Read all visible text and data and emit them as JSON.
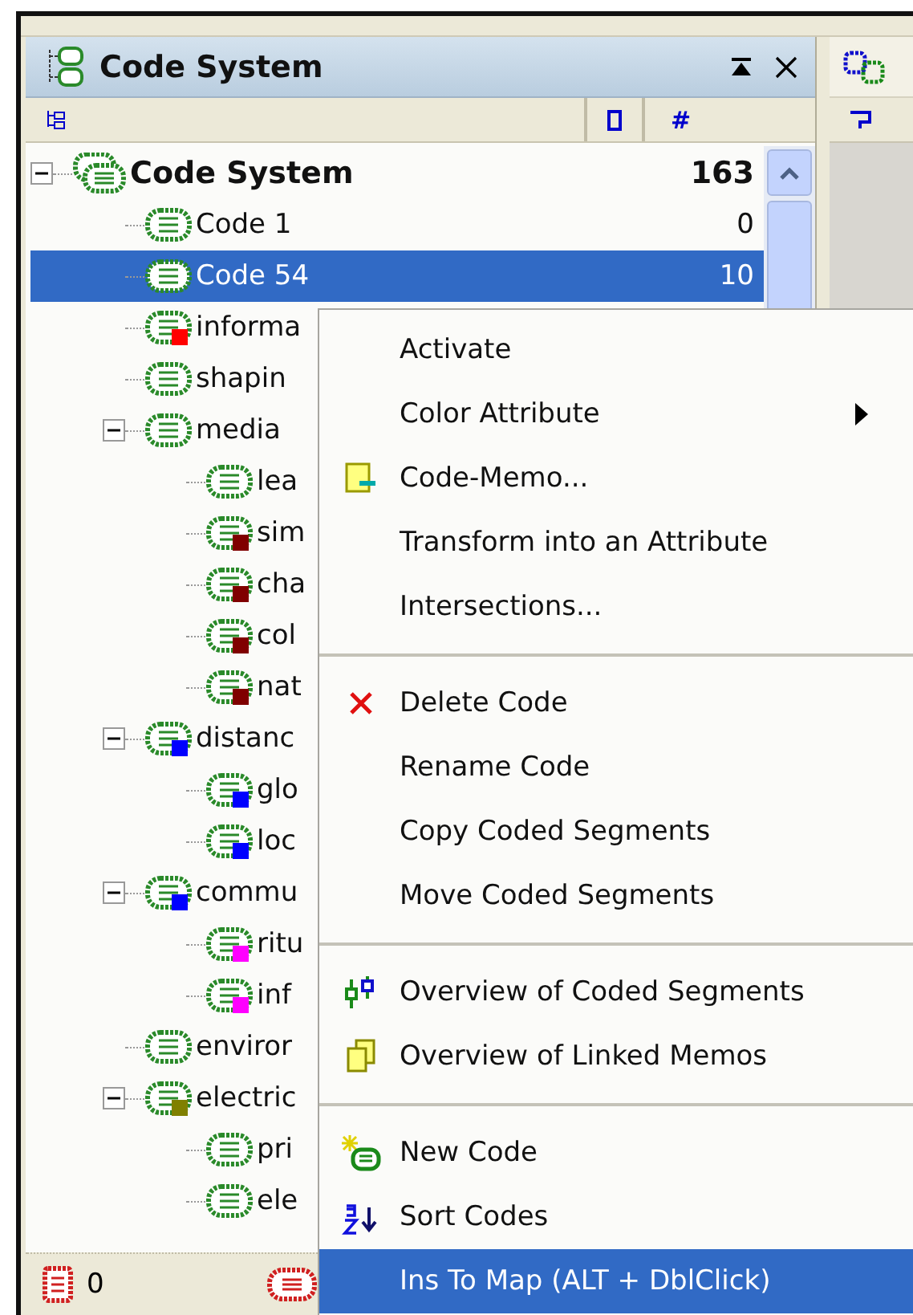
{
  "panel": {
    "title": "Code System",
    "count_header": "#"
  },
  "tree": [
    {
      "label": "Code System",
      "count": "163",
      "expanded": true,
      "selected": false,
      "children": [
        {
          "label": "Code 1",
          "count": "0",
          "selected": false
        },
        {
          "label": "Code 54",
          "count": "10",
          "selected": true
        },
        {
          "label": "informa",
          "color": "#ff0000",
          "selected": false
        },
        {
          "label": "shapin",
          "selected": false
        },
        {
          "label": "media",
          "expanded": true,
          "selected": false,
          "children": [
            {
              "label": "lea",
              "selected": false
            },
            {
              "label": "sim",
              "color": "#800000",
              "selected": false
            },
            {
              "label": "cha",
              "color": "#800000",
              "selected": false
            },
            {
              "label": "col",
              "color": "#800000",
              "selected": false
            },
            {
              "label": "nat",
              "color": "#800000",
              "selected": false
            }
          ]
        },
        {
          "label": "distanc",
          "color": "#0000ff",
          "expanded": true,
          "selected": false,
          "children": [
            {
              "label": "glo",
              "color": "#0000ff",
              "selected": false
            },
            {
              "label": "loc",
              "color": "#0000ff",
              "selected": false
            }
          ]
        },
        {
          "label": "commu",
          "color": "#0000ff",
          "expanded": true,
          "selected": false,
          "children": [
            {
              "label": "ritu",
              "color": "#ff00ff",
              "selected": false
            },
            {
              "label": "inf",
              "color": "#ff00ff",
              "selected": false
            }
          ]
        },
        {
          "label": "enviror",
          "selected": false
        },
        {
          "label": "electric",
          "color": "#808000",
          "expanded": true,
          "selected": false,
          "children": [
            {
              "label": "pri",
              "selected": false
            },
            {
              "label": "ele",
              "selected": false
            }
          ]
        }
      ]
    }
  ],
  "status_bar": {
    "count": "0"
  },
  "menu": [
    {
      "kind": "plain",
      "label": "Activate",
      "selected": false
    },
    {
      "kind": "submenu",
      "label": "Color Attribute",
      "selected": false
    },
    {
      "kind": "memo",
      "label": "Code-Memo...",
      "selected": false
    },
    {
      "kind": "plain",
      "label": "Transform into an Attribute",
      "selected": false
    },
    {
      "kind": "plain",
      "label": "Intersections...",
      "selected": false
    },
    {
      "kind": "separator"
    },
    {
      "kind": "delete",
      "label": "Delete Code",
      "selected": false
    },
    {
      "kind": "plain",
      "label": "Rename Code",
      "selected": false
    },
    {
      "kind": "plain",
      "label": "Copy Coded Segments",
      "selected": false
    },
    {
      "kind": "plain",
      "label": "Move Coded Segments",
      "selected": false
    },
    {
      "kind": "separator"
    },
    {
      "kind": "overview",
      "label": "Overview of Coded Segments",
      "selected": false
    },
    {
      "kind": "memos",
      "label": "Overview of Linked Memos",
      "selected": false
    },
    {
      "kind": "separator"
    },
    {
      "kind": "new",
      "label": "New Code",
      "selected": false
    },
    {
      "kind": "sort",
      "label": "Sort Codes",
      "selected": false
    },
    {
      "kind": "plain",
      "label": "Ins To Map (ALT + DblClick)",
      "selected": true
    }
  ]
}
